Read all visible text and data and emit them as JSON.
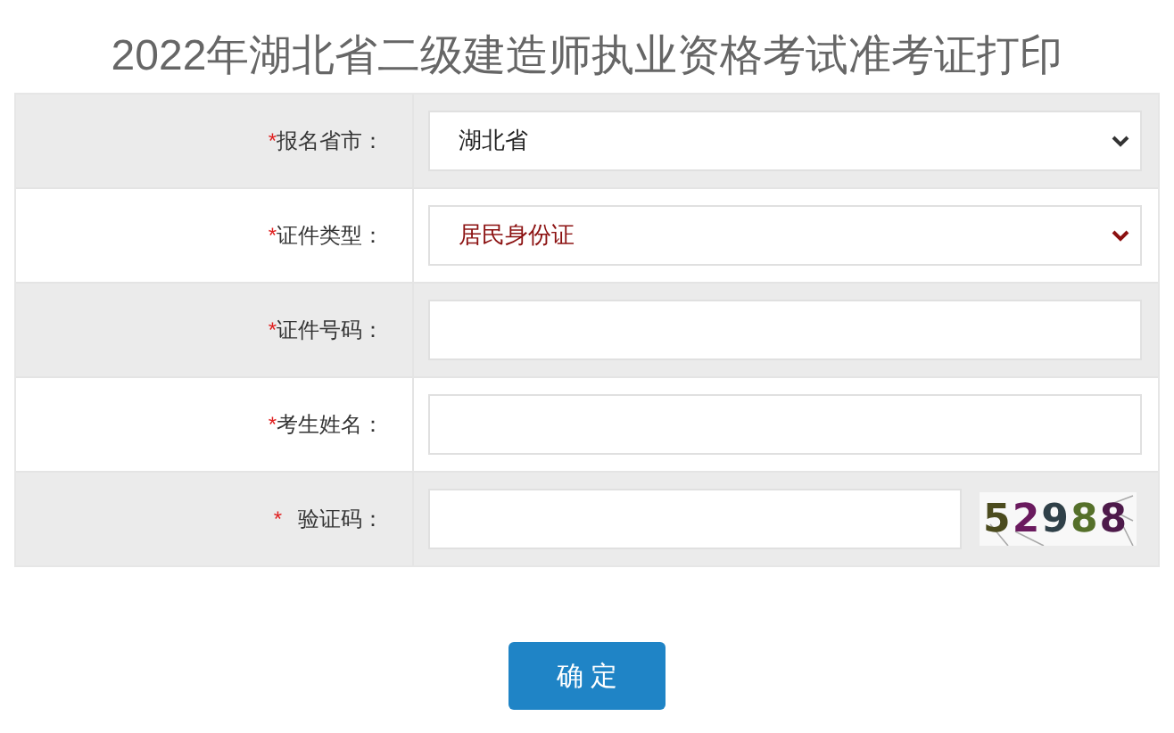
{
  "title": "2022年湖北省二级建造师执业资格考试准考证打印",
  "rows": [
    {
      "mark": "*",
      "label": "报名省市：",
      "kind": "select",
      "value": "湖北省",
      "highlighted": false,
      "mark_gap": false
    },
    {
      "mark": "*",
      "label": "证件类型：",
      "kind": "select",
      "value": "居民身份证",
      "highlighted": true,
      "mark_gap": false
    },
    {
      "mark": "*",
      "label": "证件号码：",
      "kind": "input",
      "mark_gap": false
    },
    {
      "mark": "*",
      "label": "考生姓名：",
      "kind": "input",
      "mark_gap": false
    },
    {
      "mark": "*",
      "label": "验证码：",
      "kind": "captcha",
      "captcha": "52988",
      "mark_gap": true
    }
  ],
  "submit": "确 定"
}
